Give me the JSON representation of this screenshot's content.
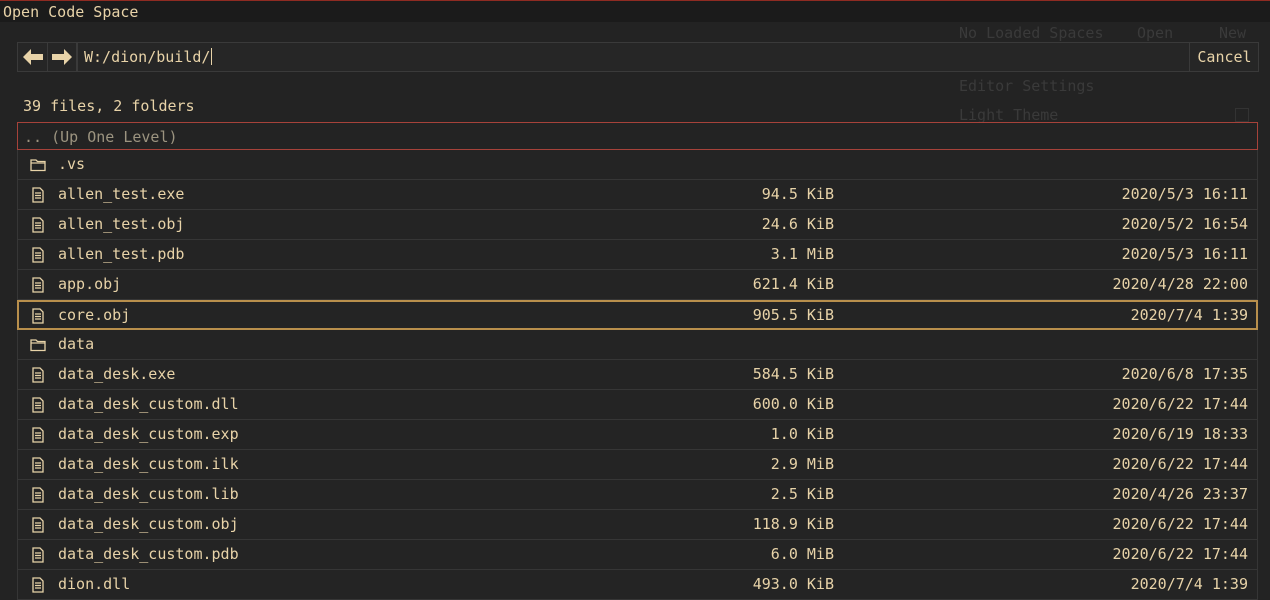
{
  "window": {
    "title": "Open Code Space"
  },
  "background_panel": {
    "no_spaces": "No Loaded Spaces",
    "open": "Open",
    "new": "New",
    "editor_settings": "Editor Settings",
    "light_theme": "Light Theme"
  },
  "path_bar": {
    "value": "W:/dion/build/",
    "cancel_label": "Cancel"
  },
  "summary": "39 files, 2 folders",
  "up_level_label": ".. (Up One Level)",
  "entries": [
    {
      "type": "folder",
      "name": ".vs",
      "size": "",
      "date": ""
    },
    {
      "type": "file",
      "name": "allen_test.exe",
      "size": "94.5 KiB",
      "date": "2020/5/3 16:11"
    },
    {
      "type": "file",
      "name": "allen_test.obj",
      "size": "24.6 KiB",
      "date": "2020/5/2 16:54"
    },
    {
      "type": "file",
      "name": "allen_test.pdb",
      "size": "3.1 MiB",
      "date": "2020/5/3 16:11"
    },
    {
      "type": "file",
      "name": "app.obj",
      "size": "621.4 KiB",
      "date": "2020/4/28 22:00"
    },
    {
      "type": "file",
      "name": "core.obj",
      "size": "905.5 KiB",
      "date": "2020/7/4 1:39",
      "selected": true
    },
    {
      "type": "folder",
      "name": "data",
      "size": "",
      "date": ""
    },
    {
      "type": "file",
      "name": "data_desk.exe",
      "size": "584.5 KiB",
      "date": "2020/6/8 17:35"
    },
    {
      "type": "file",
      "name": "data_desk_custom.dll",
      "size": "600.0 KiB",
      "date": "2020/6/22 17:44"
    },
    {
      "type": "file",
      "name": "data_desk_custom.exp",
      "size": "1.0 KiB",
      "date": "2020/6/19 18:33"
    },
    {
      "type": "file",
      "name": "data_desk_custom.ilk",
      "size": "2.9 MiB",
      "date": "2020/6/22 17:44"
    },
    {
      "type": "file",
      "name": "data_desk_custom.lib",
      "size": "2.5 KiB",
      "date": "2020/4/26 23:37"
    },
    {
      "type": "file",
      "name": "data_desk_custom.obj",
      "size": "118.9 KiB",
      "date": "2020/6/22 17:44"
    },
    {
      "type": "file",
      "name": "data_desk_custom.pdb",
      "size": "6.0 MiB",
      "date": "2020/6/22 17:44"
    },
    {
      "type": "file",
      "name": "dion.dll",
      "size": "493.0 KiB",
      "date": "2020/7/4 1:39"
    }
  ],
  "colors": {
    "text": "#e8d3a8",
    "selected_border": "#b88f4c",
    "up_level_border": "#a6423a",
    "background": "#232323"
  }
}
